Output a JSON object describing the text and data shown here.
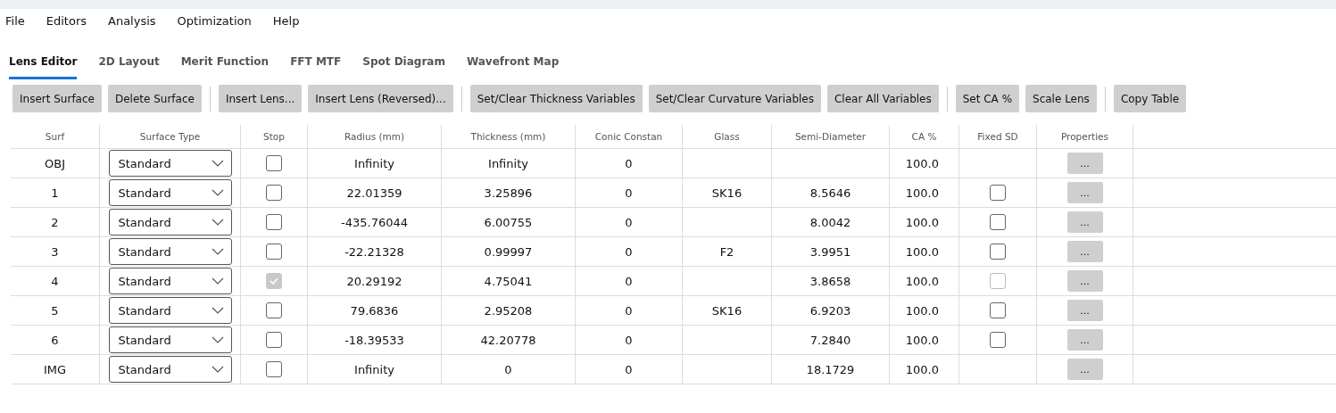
{
  "menu": [
    "File",
    "Editors",
    "Analysis",
    "Optimization",
    "Help"
  ],
  "tabs": [
    {
      "label": "Lens Editor",
      "selected": true
    },
    {
      "label": "2D Layout",
      "selected": false
    },
    {
      "label": "Merit Function",
      "selected": false
    },
    {
      "label": "FFT MTF",
      "selected": false
    },
    {
      "label": "Spot Diagram",
      "selected": false
    },
    {
      "label": "Wavefront Map",
      "selected": false
    }
  ],
  "toolbar": [
    [
      "Insert Surface",
      "Delete Surface"
    ],
    [
      "Insert Lens...",
      "Insert Lens (Reversed)..."
    ],
    [
      "Set/Clear Thickness Variables",
      "Set/Clear Curvature Variables",
      "Clear All Variables"
    ],
    [
      "Set CA %",
      "Scale Lens"
    ],
    [
      "Copy Table"
    ]
  ],
  "table": {
    "columns": [
      "Surf",
      "Surface Type",
      "Stop",
      "Radius (mm)",
      "Thickness (mm)",
      "Conic Constan",
      "Glass",
      "Semi-Diameter",
      "CA %",
      "Fixed SD",
      "Properties"
    ],
    "rows": [
      {
        "surf": "OBJ",
        "type": "Standard",
        "stop": {
          "checked": false,
          "disabled": false
        },
        "radius": "Infinity",
        "thickness": "Infinity",
        "conic": "0",
        "ca": "100.0",
        "properties": "..."
      },
      {
        "surf": "1",
        "type": "Standard",
        "stop": {
          "checked": false,
          "disabled": false
        },
        "radius": "22.01359",
        "thickness": "3.25896",
        "conic": "0",
        "glass": "SK16",
        "semi_diameter": "8.5646",
        "ca": "100.0",
        "fixed_sd": {
          "checked": false,
          "disabled": false
        },
        "properties": "..."
      },
      {
        "surf": "2",
        "type": "Standard",
        "stop": {
          "checked": false,
          "disabled": false
        },
        "radius": "-435.76044",
        "thickness": "6.00755",
        "conic": "0",
        "semi_diameter": "8.0042",
        "ca": "100.0",
        "fixed_sd": {
          "checked": false,
          "disabled": false
        },
        "properties": "..."
      },
      {
        "surf": "3",
        "type": "Standard",
        "stop": {
          "checked": false,
          "disabled": false
        },
        "radius": "-22.21328",
        "thickness": "0.99997",
        "conic": "0",
        "glass": "F2",
        "semi_diameter": "3.9951",
        "ca": "100.0",
        "fixed_sd": {
          "checked": false,
          "disabled": false
        },
        "properties": "..."
      },
      {
        "surf": "4",
        "type": "Standard",
        "stop": {
          "checked": true,
          "disabled": true
        },
        "radius": "20.29192",
        "thickness": "4.75041",
        "conic": "0",
        "semi_diameter": "3.8658",
        "ca": "100.0",
        "fixed_sd": {
          "checked": false,
          "disabled": true
        },
        "properties": "..."
      },
      {
        "surf": "5",
        "type": "Standard",
        "stop": {
          "checked": false,
          "disabled": false
        },
        "radius": "79.6836",
        "thickness": "2.95208",
        "conic": "0",
        "glass": "SK16",
        "semi_diameter": "6.9203",
        "ca": "100.0",
        "fixed_sd": {
          "checked": false,
          "disabled": false
        },
        "properties": "..."
      },
      {
        "surf": "6",
        "type": "Standard",
        "stop": {
          "checked": false,
          "disabled": false
        },
        "radius": "-18.39533",
        "thickness": "42.20778",
        "conic": "0",
        "semi_diameter": "7.2840",
        "ca": "100.0",
        "fixed_sd": {
          "checked": false,
          "disabled": false
        },
        "properties": "..."
      },
      {
        "surf": "IMG",
        "type": "Standard",
        "stop": {
          "checked": false,
          "disabled": false
        },
        "radius": "Infinity",
        "thickness": "0",
        "conic": "0",
        "semi_diameter": "18.1729",
        "ca": "100.0",
        "properties": "..."
      }
    ]
  }
}
